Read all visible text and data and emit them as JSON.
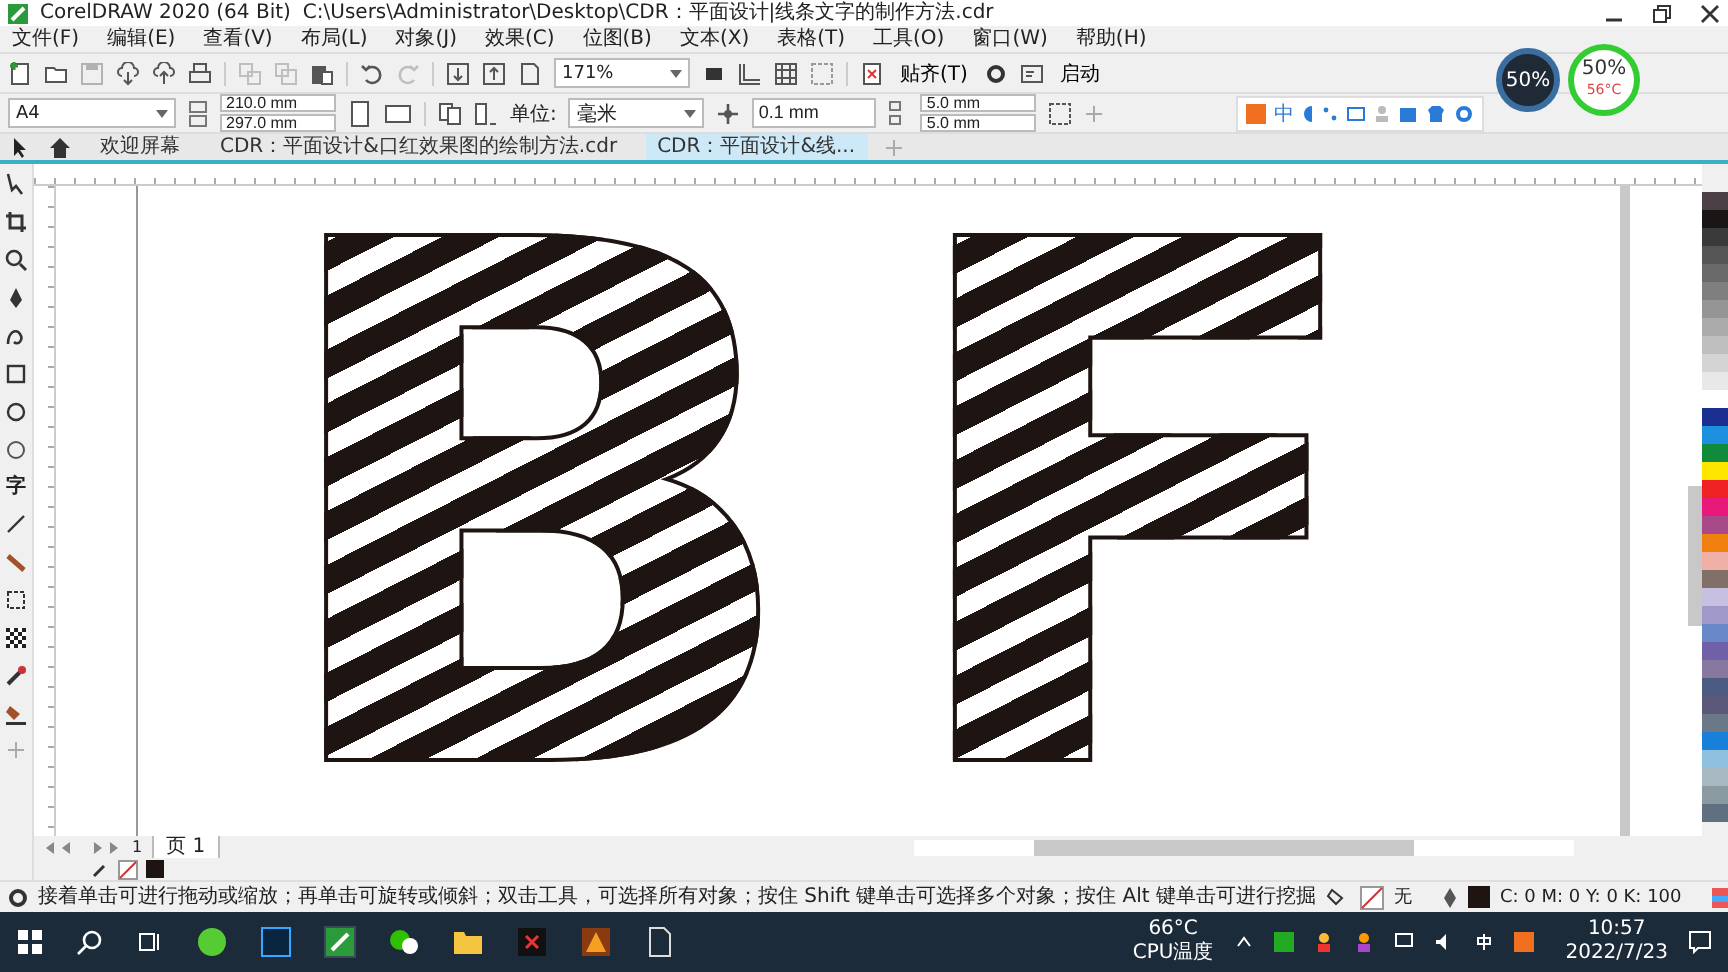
{
  "window": {
    "title": "CorelDRAW 2020 (64 Bit)",
    "path": "C:\\Users\\Administrator\\Desktop\\CDR：平面设计|线条文字的制作方法.cdr"
  },
  "menu": [
    "文件(F)",
    "编辑(E)",
    "查看(V)",
    "布局(L)",
    "对象(J)",
    "效果(C)",
    "位图(B)",
    "文本(X)",
    "表格(T)",
    "工具(O)",
    "窗口(W)",
    "帮助(H)"
  ],
  "toolbar": {
    "zoom": "171%",
    "snap": "贴齐(T)",
    "launch": "启动"
  },
  "property_bar": {
    "page_size": "A4",
    "width": "210.0 mm",
    "height": "297.0 mm",
    "unit_label": "单位:",
    "unit": "毫米",
    "nudge": "0.1 mm",
    "dup_x": "5.0 mm",
    "dup_y": "5.0 mm"
  },
  "ime_bar": {
    "mode": "中"
  },
  "monitor": {
    "cpu": "50%",
    "memory": "50%",
    "temp": "56°C"
  },
  "tabs": [
    {
      "label": "欢迎屏幕",
      "selected": false
    },
    {
      "label": "CDR：平面设计&口红效果图的绘制方法.cdr",
      "selected": false
    },
    {
      "label": "CDR：平面设计&线...",
      "selected": true
    }
  ],
  "toolbox": {
    "text_tool": "字"
  },
  "artwork": {
    "text": "BF"
  },
  "palette": [
    {
      "color": "#4a4045"
    },
    {
      "color": "#1a1616"
    },
    {
      "color": "#3a3a3a"
    },
    {
      "color": "#555555"
    },
    {
      "color": "#6a6a6a"
    },
    {
      "color": "#7f7f7f"
    },
    {
      "color": "#959595"
    },
    {
      "color": "#aaaaaa"
    },
    {
      "color": "#bfbfbf"
    },
    {
      "color": "#d4d4d4"
    },
    {
      "color": "#e8e8e8"
    },
    {
      "color": "#ffffff"
    },
    {
      "color": "#1a2f8f"
    },
    {
      "color": "#1e90e0"
    },
    {
      "color": "#128a3c"
    },
    {
      "color": "#ffe600"
    },
    {
      "color": "#ee2222"
    },
    {
      "color": "#e8197a"
    },
    {
      "color": "#a84a8a"
    },
    {
      "color": "#f08010"
    },
    {
      "color": "#f0b0a8"
    },
    {
      "color": "#807068"
    },
    {
      "color": "#c8c0e0"
    },
    {
      "color": "#a098c8"
    },
    {
      "color": "#6888c8"
    },
    {
      "color": "#7060a8"
    },
    {
      "color": "#8878a0"
    },
    {
      "color": "#4a5a80"
    },
    {
      "color": "#5a5a78"
    },
    {
      "color": "#6a7888"
    },
    {
      "color": "#1880d8"
    },
    {
      "color": "#90c0e0"
    },
    {
      "color": "#a8b8c0"
    },
    {
      "color": "#8a9aa0"
    },
    {
      "color": "#607080"
    }
  ],
  "pages": {
    "current": "1",
    "tab": "页 1"
  },
  "status": {
    "hint": "接着单击可进行拖动或缩放；再单击可旋转或倾斜；双击工具，可选择所有对象；按住 Shift 键单击可选择多个对象；按住 Alt 键单击可进行挖掘",
    "fill": "无",
    "outline": "C: 0 M: 0 Y: 0 K: 100"
  },
  "taskbar": {
    "temp": "66°C",
    "temp_label": "CPU温度",
    "time": "10:57",
    "date": "2022/7/23"
  }
}
